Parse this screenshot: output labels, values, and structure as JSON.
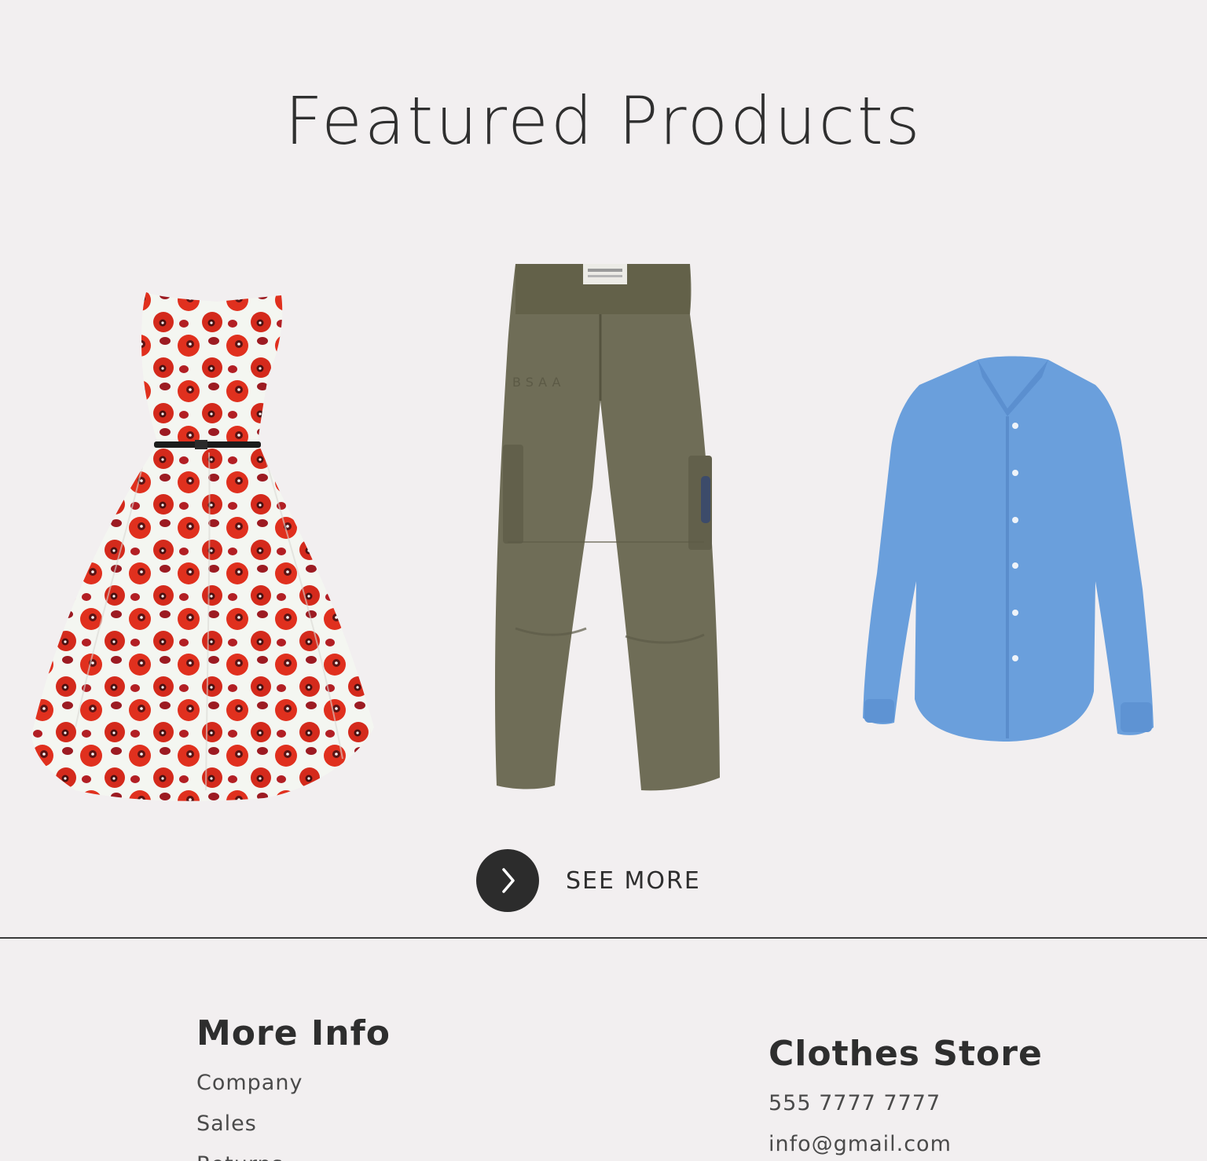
{
  "featured": {
    "title": "Featured Products",
    "products": [
      {
        "name": "dress",
        "icon": "floral-dress-image"
      },
      {
        "name": "pants",
        "icon": "cargo-pants-image"
      },
      {
        "name": "shirt",
        "icon": "blue-shirt-image"
      }
    ],
    "see_more_label": "SEE MORE"
  },
  "footer": {
    "more_info": {
      "heading": "More Info",
      "links": [
        "Company",
        "Sales",
        "Returns"
      ]
    },
    "store": {
      "heading": "Clothes Store",
      "phone": "555 7777 7777",
      "email": "info@gmail.com"
    }
  },
  "colors": {
    "background": "#f2eff0",
    "button": "#2c2c2c",
    "text": "#2e2e2e"
  }
}
